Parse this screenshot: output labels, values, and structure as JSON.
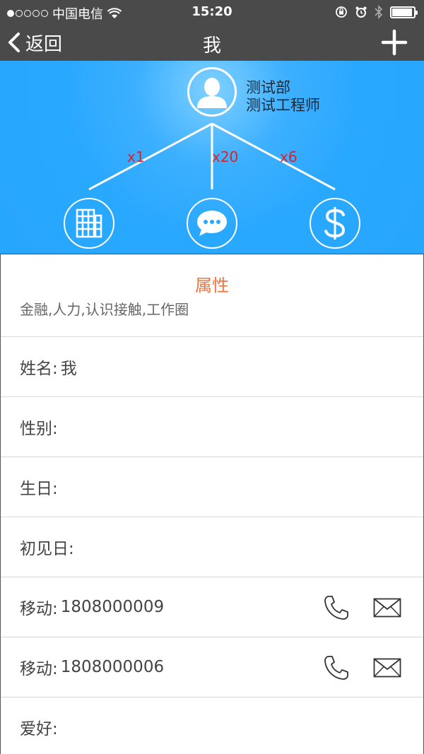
{
  "status_bar": {
    "carrier": "中国电信",
    "time": "15:20",
    "battery_level": 0.95
  },
  "nav": {
    "back_label": "返回",
    "title": "我",
    "add_icon": "plus-icon"
  },
  "profile": {
    "department": "测试部",
    "role": "测试工程师",
    "avatar_icon": "user-avatar-icon",
    "counts": [
      {
        "label": "x1",
        "icon": "building-icon"
      },
      {
        "label": "x20",
        "icon": "chat-bubble-icon"
      },
      {
        "label": "x6",
        "icon": "dollar-icon"
      }
    ]
  },
  "attributes": {
    "title": "属性",
    "tags": "金融,人力,认识接触,工作圈"
  },
  "fields": {
    "name": {
      "label": "姓名:",
      "value": "我"
    },
    "gender": {
      "label": "性别:",
      "value": ""
    },
    "birthday": {
      "label": "生日:",
      "value": ""
    },
    "first_met": {
      "label": "初见日:",
      "value": ""
    },
    "mobile1": {
      "label": "移动:",
      "value": "1808000009"
    },
    "mobile2": {
      "label": "移动:",
      "value": "1808000006"
    },
    "hobby": {
      "label": "爱好:",
      "value": ""
    }
  },
  "colors": {
    "header_blue": "#29a8ff",
    "accent_orange": "#f3733f",
    "count_red": "#d8232a",
    "bar_gray": "#4a4a4a"
  }
}
